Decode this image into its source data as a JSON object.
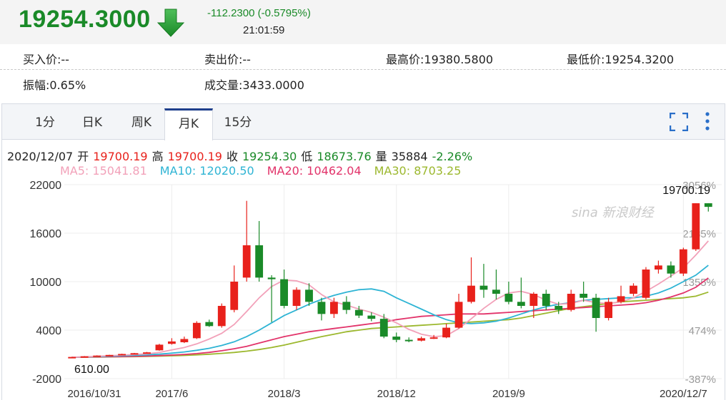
{
  "quote": {
    "price": "19254.3000",
    "change": "-112.2300 (-0.5795%)",
    "time": "21:01:59",
    "arrow_icon": "down-arrow-icon",
    "down_color": "#1a8a28",
    "up_color": "#e8211b"
  },
  "stats": {
    "buy": "买入价:--",
    "sell": "卖出价:--",
    "high": "最高价:19380.5800",
    "low": "最低价:19254.3200",
    "amplitude": "振幅:0.65%",
    "volume": "成交量:3433.0000"
  },
  "tabs": [
    "1分",
    "日K",
    "周K",
    "月K",
    "15分"
  ],
  "active_tab": "月K",
  "toolbar": {
    "fullscreen_icon": "fullscreen-icon",
    "more_icon": "more-vertical-icon"
  },
  "info": {
    "date": "2020/12/07",
    "open_label": "开",
    "open": "19700.19",
    "high_label": "高",
    "high": "19700.19",
    "close_label": "收",
    "close": "19254.30",
    "low_label": "低",
    "low": "18673.76",
    "vol_label": "量",
    "vol": "35884",
    "pct": "-2.26%"
  },
  "ma": {
    "ma5": "MA5: 15041.81",
    "ma10": "MA10: 12020.50",
    "ma20": "MA20: 10462.04",
    "ma30": "MA30: 8703.25",
    "ma5_color": "#f2a1b9",
    "ma10_color": "#2eb4d4",
    "ma20_color": "#e2336a",
    "ma30_color": "#9cb82e"
  },
  "watermark": "sina 新浪财经",
  "chart_data": {
    "type": "candlestick",
    "y_ticks": [
      "22000",
      "16000",
      "10000",
      "4000",
      "-2000"
    ],
    "y_tick_values": [
      22000,
      16000,
      10000,
      4000,
      -2000
    ],
    "ylim": [
      -2000,
      22000
    ],
    "right_ticks": [
      "3056%",
      "2185%",
      "1355%",
      "474%",
      "-387%"
    ],
    "x_labels": [
      "2016/10/31",
      "2017/6",
      "2018/3",
      "2018/12",
      "2019/9",
      "2020/12/7"
    ],
    "x_label_index": [
      0,
      8,
      17,
      26,
      35,
      49
    ],
    "annotation_high": "19700.19",
    "annotation_low": "610.00",
    "candles": [
      {
        "o": 610,
        "c": 680,
        "h": 700,
        "l": 600
      },
      {
        "o": 680,
        "c": 760,
        "h": 790,
        "l": 660
      },
      {
        "o": 760,
        "c": 850,
        "h": 880,
        "l": 740
      },
      {
        "o": 850,
        "c": 930,
        "h": 950,
        "l": 820
      },
      {
        "o": 930,
        "c": 1050,
        "h": 1080,
        "l": 900
      },
      {
        "o": 1050,
        "c": 1150,
        "h": 1180,
        "l": 1020
      },
      {
        "o": 1150,
        "c": 1250,
        "h": 1300,
        "l": 1120
      },
      {
        "o": 1500,
        "c": 2200,
        "h": 2300,
        "l": 1450
      },
      {
        "o": 2300,
        "c": 2600,
        "h": 3000,
        "l": 2200
      },
      {
        "o": 2500,
        "c": 2900,
        "h": 3200,
        "l": 2400
      },
      {
        "o": 3000,
        "c": 4900,
        "h": 5100,
        "l": 2900
      },
      {
        "o": 5000,
        "c": 4500,
        "h": 5300,
        "l": 4400
      },
      {
        "o": 4500,
        "c": 7000,
        "h": 7300,
        "l": 4300
      },
      {
        "o": 6500,
        "c": 10000,
        "h": 12000,
        "l": 6200
      },
      {
        "o": 10500,
        "c": 14500,
        "h": 20000,
        "l": 10000
      },
      {
        "o": 14500,
        "c": 10500,
        "h": 17500,
        "l": 10000
      },
      {
        "o": 10500,
        "c": 10300,
        "h": 10800,
        "l": 5000
      },
      {
        "o": 10300,
        "c": 7000,
        "h": 11500,
        "l": 6700
      },
      {
        "o": 7000,
        "c": 9000,
        "h": 9300,
        "l": 6500
      },
      {
        "o": 9000,
        "c": 7500,
        "h": 9800,
        "l": 7000
      },
      {
        "o": 7500,
        "c": 6000,
        "h": 8000,
        "l": 5200
      },
      {
        "o": 6000,
        "c": 7500,
        "h": 8000,
        "l": 5500
      },
      {
        "o": 7500,
        "c": 6500,
        "h": 8200,
        "l": 6000
      },
      {
        "o": 6500,
        "c": 5800,
        "h": 7000,
        "l": 5500
      },
      {
        "o": 5800,
        "c": 5400,
        "h": 6200,
        "l": 5100
      },
      {
        "o": 5400,
        "c": 3200,
        "h": 6000,
        "l": 3000
      },
      {
        "o": 3200,
        "c": 2800,
        "h": 3700,
        "l": 2500
      },
      {
        "o": 2800,
        "c": 2700,
        "h": 3100,
        "l": 2500
      },
      {
        "o": 2700,
        "c": 3000,
        "h": 3200,
        "l": 2600
      },
      {
        "o": 3000,
        "c": 3100,
        "h": 3400,
        "l": 2900
      },
      {
        "o": 3100,
        "c": 4300,
        "h": 4800,
        "l": 3000
      },
      {
        "o": 4300,
        "c": 7500,
        "h": 8500,
        "l": 4200
      },
      {
        "o": 7500,
        "c": 9500,
        "h": 13000,
        "l": 7300
      },
      {
        "o": 9500,
        "c": 9000,
        "h": 12200,
        "l": 8000
      },
      {
        "o": 9000,
        "c": 8500,
        "h": 11500,
        "l": 7800
      },
      {
        "o": 8500,
        "c": 7500,
        "h": 10000,
        "l": 7200
      },
      {
        "o": 7500,
        "c": 7000,
        "h": 10500,
        "l": 6700
      },
      {
        "o": 7000,
        "c": 8500,
        "h": 8700,
        "l": 5500
      },
      {
        "o": 8500,
        "c": 7000,
        "h": 9000,
        "l": 6500
      },
      {
        "o": 7000,
        "c": 6500,
        "h": 7500,
        "l": 6000
      },
      {
        "o": 6500,
        "c": 8500,
        "h": 9000,
        "l": 6300
      },
      {
        "o": 8500,
        "c": 8000,
        "h": 10000,
        "l": 7500
      },
      {
        "o": 8000,
        "c": 5500,
        "h": 8500,
        "l": 3800
      },
      {
        "o": 5500,
        "c": 7500,
        "h": 8000,
        "l": 5200
      },
      {
        "o": 7500,
        "c": 8200,
        "h": 9500,
        "l": 7300
      },
      {
        "o": 8500,
        "c": 9500,
        "h": 9800,
        "l": 8200
      },
      {
        "o": 8000,
        "c": 11500,
        "h": 11800,
        "l": 7800
      },
      {
        "o": 11500,
        "c": 12000,
        "h": 12600,
        "l": 11000
      },
      {
        "o": 12000,
        "c": 11000,
        "h": 12500,
        "l": 10500
      },
      {
        "o": 11000,
        "c": 14000,
        "h": 14200,
        "l": 10700
      }
    ],
    "extra_candles": [
      {
        "o": 14000,
        "c": 19700.19,
        "h": 19700.19,
        "l": 13800
      },
      {
        "o": 19700.19,
        "c": 19254.3,
        "h": 19700.19,
        "l": 18673.76
      }
    ],
    "ma5": [
      650,
      700,
      760,
      830,
      900,
      980,
      1060,
      1250,
      1550,
      1850,
      2300,
      2900,
      3600,
      4700,
      6300,
      8000,
      9400,
      10200,
      10100,
      9600,
      8400,
      7500,
      7100,
      6600,
      6200,
      5600,
      4900,
      4100,
      3500,
      3200,
      3300,
      4200,
      5400,
      6700,
      7800,
      8600,
      8800,
      8400,
      7700,
      7200,
      7300,
      7700,
      7400,
      7300,
      7500,
      8000,
      8800,
      9700,
      10700,
      11700,
      13300,
      15041.81
    ],
    "ma10": [
      650,
      680,
      720,
      770,
      820,
      880,
      940,
      1030,
      1150,
      1300,
      1500,
      1750,
      2100,
      2550,
      3200,
      4000,
      4900,
      5800,
      6500,
      7200,
      7800,
      8300,
      8700,
      9000,
      9100,
      8800,
      8000,
      7300,
      6600,
      5900,
      5300,
      4900,
      4800,
      4900,
      5100,
      5500,
      6000,
      6500,
      6900,
      7200,
      7400,
      7700,
      7800,
      7900,
      8000,
      8000,
      8200,
      8600,
      9200,
      10000,
      10800,
      12020.5
    ],
    "ma20": [
      650,
      660,
      680,
      700,
      730,
      760,
      800,
      850,
      910,
      990,
      1100,
      1250,
      1450,
      1700,
      2000,
      2400,
      2800,
      3200,
      3500,
      3800,
      4000,
      4200,
      4400,
      4600,
      4800,
      5000,
      5300,
      5500,
      5700,
      5800,
      5900,
      6000,
      6000,
      6000,
      6100,
      6200,
      6300,
      6400,
      6500,
      6600,
      6700,
      6800,
      6900,
      7000,
      7100,
      7200,
      7400,
      7700,
      8100,
      8600,
      9300,
      10462.04
    ],
    "ma30": [
      650,
      655,
      665,
      680,
      700,
      720,
      745,
      780,
      820,
      870,
      940,
      1020,
      1120,
      1240,
      1400,
      1600,
      1850,
      2150,
      2500,
      2850,
      3200,
      3500,
      3800,
      4000,
      4200,
      4300,
      4400,
      4500,
      4600,
      4700,
      4800,
      4900,
      5000,
      5100,
      5200,
      5300,
      5500,
      5800,
      6100,
      6400,
      6700,
      6900,
      7100,
      7300,
      7500,
      7600,
      7700,
      7800,
      7900,
      8000,
      8200,
      8703.25
    ]
  }
}
